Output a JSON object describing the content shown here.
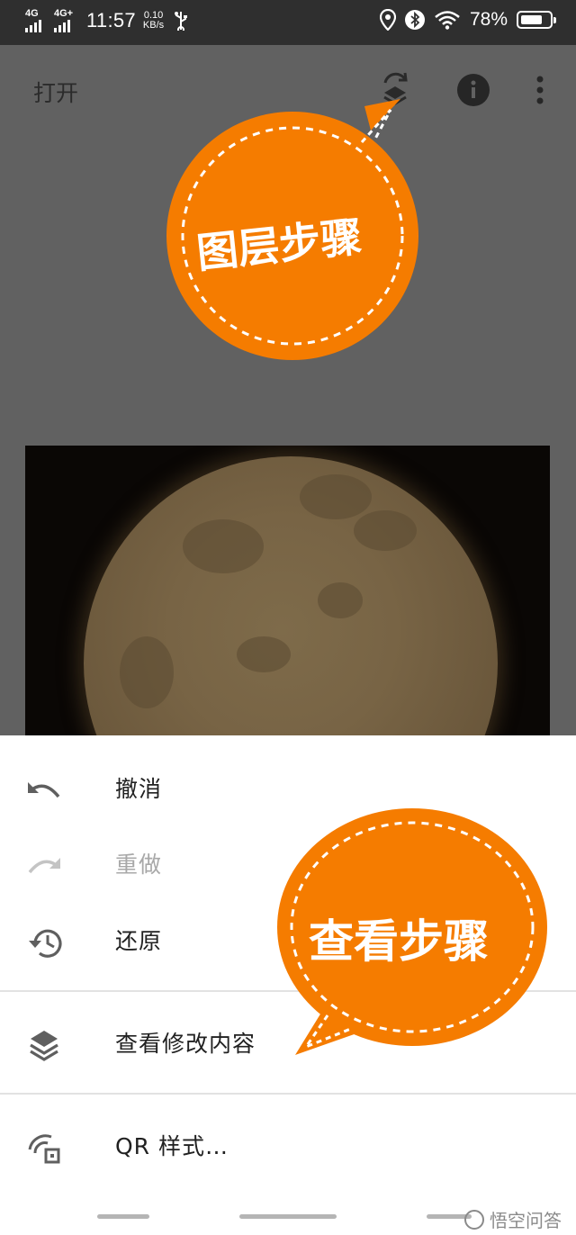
{
  "status_bar": {
    "signal_1": "4G",
    "signal_2": "4G+",
    "time": "11:57",
    "speed_value": "0.10",
    "speed_unit": "KB/s",
    "battery": "78%",
    "battery_level": 0.78
  },
  "app_bar": {
    "open_label": "打开",
    "icons": [
      "history-layers-icon",
      "info-icon",
      "more-vert-icon"
    ]
  },
  "image": {
    "subject": "moon-photo"
  },
  "menu": {
    "items": [
      {
        "label": "撤消",
        "icon": "undo-icon",
        "enabled": true
      },
      {
        "label": "重做",
        "icon": "redo-icon",
        "enabled": false
      },
      {
        "label": "还原",
        "icon": "restore-history-icon",
        "enabled": true
      },
      {
        "label": "查看修改内容",
        "icon": "layers-icon",
        "enabled": true
      },
      {
        "label": "QR 样式…",
        "icon": "qr-style-icon",
        "enabled": true
      }
    ]
  },
  "callouts": {
    "top": "图层步骤",
    "bottom": "查看步骤",
    "color": "#f57c00"
  },
  "watermark": "悟空问答"
}
